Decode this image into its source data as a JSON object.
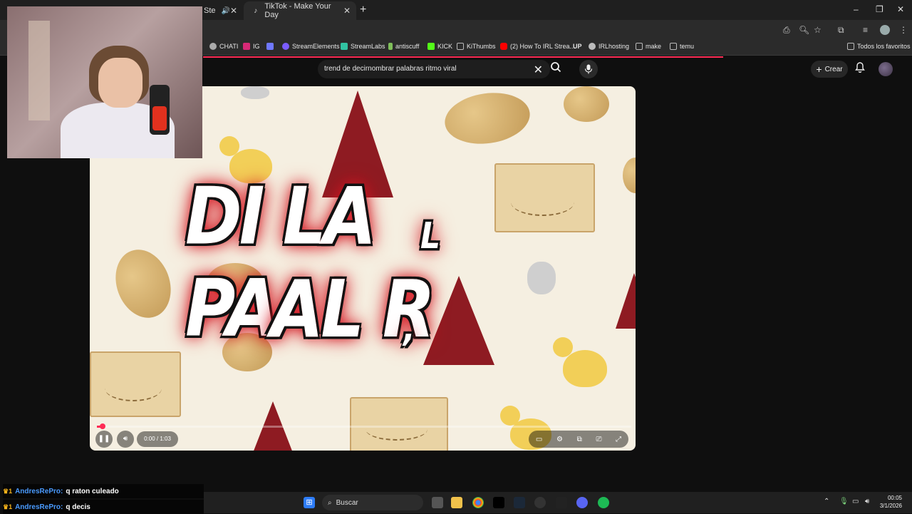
{
  "browser": {
    "tabs": [
      {
        "label": "Ste",
        "active": false
      },
      {
        "label": "TikTok - Make Your Day",
        "active": true
      }
    ],
    "new_tab": "+",
    "window_controls": {
      "minimize": "–",
      "restore": "❐",
      "close": "✕"
    }
  },
  "bookmarks": [
    {
      "label": "CHATI",
      "icon": "openai-icon",
      "color": "#cfcfcf"
    },
    {
      "label": "IG",
      "icon": "instagram-icon",
      "color": "#d62976"
    },
    {
      "label": "",
      "icon": "chart-icon",
      "color": "#6f78ff"
    },
    {
      "label": "StreamElements",
      "icon": "streamelements-icon",
      "color": "#7b5cff"
    },
    {
      "label": "StreamLabs",
      "icon": "streamlabs-icon",
      "color": "#31c3a2"
    },
    {
      "label": "antiscuff",
      "icon": "bars-icon",
      "color": "#7fbf5a"
    },
    {
      "label": "KICK",
      "icon": "kick-icon",
      "color": "#53fc18"
    },
    {
      "label": "KiThumbs",
      "icon": "kithumbs-icon",
      "color": "#bbbbbb"
    },
    {
      "label": "(2) How To IRL Strea...",
      "icon": "youtube-icon",
      "color": "#ff0000"
    },
    {
      "label": "UP",
      "icon": "up-icon",
      "color": "#ffffff"
    },
    {
      "label": "IRLhosting",
      "icon": "globe-icon",
      "color": "#bbbbbb"
    },
    {
      "label": "make",
      "icon": "folder-icon",
      "color": "#bbbbbb"
    },
    {
      "label": "temu",
      "icon": "folder-icon",
      "color": "#bbbbbb"
    }
  ],
  "bookmarks_all": "Todos los favoritos",
  "search": {
    "value": "trend de decirnombrar palabras ritmo viral",
    "clear": "✕"
  },
  "header": {
    "create_label": "Crear"
  },
  "video": {
    "overlay_line1": "DI LA PA",
    "overlay_line1_suffix": "L",
    "overlay_line2": "AL R",
    "overlay_line2_suffix": ",",
    "time": "0:00 / 1:03",
    "progress": 0.01
  },
  "chat": [
    {
      "badge": "♛1",
      "user": "AndresRePro:",
      "message": "q raton culeado"
    },
    {
      "badge": "♛1",
      "user": "AndresRePro:",
      "message": "q decis"
    }
  ],
  "taskbar": {
    "search_placeholder": "Buscar",
    "time": "00:05",
    "date": "3/1/2026"
  },
  "colors": {
    "accent": "#fe2c55",
    "page_bg": "#0f0f0f"
  }
}
